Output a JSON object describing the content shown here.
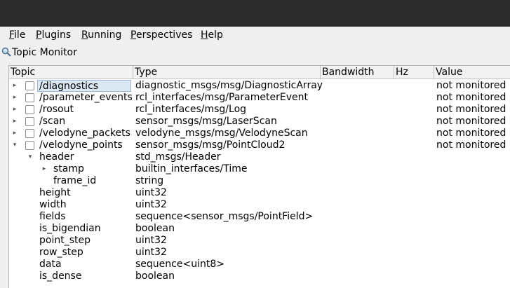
{
  "menu": {
    "items": [
      {
        "key": "F",
        "rest": "ile"
      },
      {
        "key": "P",
        "rest": "lugins"
      },
      {
        "key": "R",
        "rest": "unning"
      },
      {
        "key": "P",
        "rest": "erspectives",
        "pre": ""
      },
      {
        "key": "H",
        "rest": "elp"
      }
    ]
  },
  "plugin": {
    "title": "Topic Monitor",
    "icon": "magnifier-icon"
  },
  "columns": {
    "topic": "Topic",
    "type": "Type",
    "bandwidth": "Bandwidth",
    "hz": "Hz",
    "value": "Value"
  },
  "rows": [
    {
      "topic": "/diagnostics",
      "type": "diagnostic_msgs/msg/DiagnosticArray",
      "value": "not monitored"
    },
    {
      "topic": "/parameter_events",
      "type": "rcl_interfaces/msg/ParameterEvent",
      "value": "not monitored"
    },
    {
      "topic": "/rosout",
      "type": "rcl_interfaces/msg/Log",
      "value": "not monitored"
    },
    {
      "topic": "/scan",
      "type": "sensor_msgs/msg/LaserScan",
      "value": "not monitored"
    },
    {
      "topic": "/velodyne_packets",
      "type": "velodyne_msgs/msg/VelodyneScan",
      "value": "not monitored"
    },
    {
      "topic": "/velodyne_points",
      "type": "sensor_msgs/msg/PointCloud2",
      "value": "not monitored"
    }
  ],
  "fields": [
    {
      "name": "header",
      "type": "std_msgs/Header"
    },
    {
      "name": "stamp",
      "type": "builtin_interfaces/Time"
    },
    {
      "name": "frame_id",
      "type": "string"
    },
    {
      "name": "height",
      "type": "uint32"
    },
    {
      "name": "width",
      "type": "uint32"
    },
    {
      "name": "fields",
      "type": "sequence<sensor_msgs/PointField>"
    },
    {
      "name": "is_bigendian",
      "type": "boolean"
    },
    {
      "name": "point_step",
      "type": "uint32"
    },
    {
      "name": "row_step",
      "type": "uint32"
    },
    {
      "name": "data",
      "type": "sequence<uint8>"
    },
    {
      "name": "is_dense",
      "type": "boolean"
    }
  ]
}
